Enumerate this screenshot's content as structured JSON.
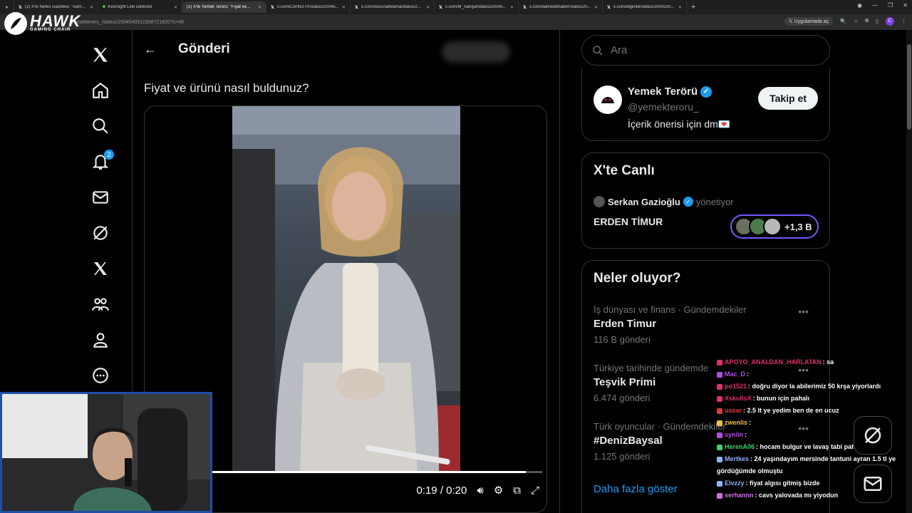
{
  "browser": {
    "tabs": [
      {
        "label": "(2) X'te Nefes Gazetesi: \"Sams..."
      },
      {
        "label": "KickSight Link Detector"
      },
      {
        "label": "(2) X'te Yemek Terörü: \"Fiyat ve..."
      },
      {
        "label": "x.com/ConflictTR/status/20045..."
      },
      {
        "label": "x.com/bosunatiklama/status/20..."
      },
      {
        "label": "x.com/M_Sarigul/status/20045..."
      },
      {
        "label": "x.com/darkwebhaber/status/20..."
      },
      {
        "label": "x.com/etgiinlik/status/2004250..."
      }
    ],
    "url": "yemekteroru_/status/2004540511508721820?s=46",
    "open_in_app": "Uygulamada aç",
    "profile_letter": "C"
  },
  "overlay": {
    "brand": "HAWK",
    "brand_sub": "GAMING CHAIR"
  },
  "nav": {
    "notification_count": "2"
  },
  "header": {
    "title": "Gönderi"
  },
  "post": {
    "text": "Fiyat ve ürünü nasıl buldunuz?"
  },
  "video": {
    "time": "0:19 / 0:20",
    "progress": 0.95
  },
  "search": {
    "placeholder": "Ara"
  },
  "profile_card": {
    "name": "Yemek Terörü",
    "handle": "@yemekteroru_",
    "bio": "İçerik önerisi için dm💌",
    "follow_label": "Takip et"
  },
  "live": {
    "heading": "X'te Canlı",
    "host": "Serkan Gazioğlu",
    "host_role": "yönetiyor",
    "title": "ERDEN TİMUR",
    "listeners": "+1,3 B"
  },
  "trends": {
    "heading": "Neler oluyor?",
    "items": [
      {
        "context": "İş dünyası ve finans · Gündemdekiler",
        "title": "Erden Timur",
        "count": "116 B gönderi"
      },
      {
        "context": "Türkiye tarihinde gündemde",
        "title": "Teşvik Primi",
        "count": "6.474 gönderi"
      },
      {
        "context": "Türk oyuncular · Gündemdekiler",
        "title": "#DenizBaysal",
        "count": "1.125 gönderi"
      }
    ],
    "show_more": "Daha fazla göster"
  },
  "chat": [
    {
      "user": "APOYO_ANALDAN_HARLATAN",
      "text": "sa",
      "color": "#e0306a"
    },
    {
      "user": "Mac_D",
      "text": "",
      "color": "#b14fe0"
    },
    {
      "user": "po1521",
      "text": "doğru diyor la abilerimiz 50 krşa yiyorlardı",
      "color": "#e0306a"
    },
    {
      "user": "XskullsX",
      "text": "bunun için pahalı",
      "color": "#e0306a"
    },
    {
      "user": "uasar",
      "text": "2.5 lt ye yedim ben de en ucuz",
      "color": "#e03838"
    },
    {
      "user": "zwenlis",
      "text": "",
      "color": "#f0c040"
    },
    {
      "user": "syniin",
      "text": "",
      "color": "#b14fe0"
    },
    {
      "user": "HerenA06",
      "text": "hocam bulgur ve lavaş tabi pahalı",
      "color": "#3fd06a"
    },
    {
      "user": "Mertkes",
      "text": "24 yaşındayım mersinde tantuni ayran 1.5 tl ye gördüğümde olmuştu",
      "color": "#8ab4f8"
    },
    {
      "user": "Elvzzy",
      "text": "fiyat algısı gitmiş bizde",
      "color": "#8ab4f8"
    },
    {
      "user": "serhannn",
      "text": "cavs yalovada mı yiyodun",
      "color": "#d070e0"
    }
  ]
}
